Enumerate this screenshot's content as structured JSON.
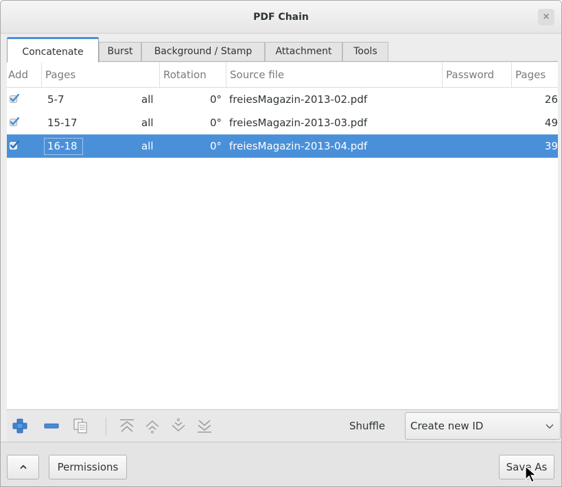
{
  "window": {
    "title": "PDF Chain",
    "close_glyph": "×"
  },
  "tabs": [
    {
      "label": "Concatenate",
      "active": true
    },
    {
      "label": "Burst",
      "active": false
    },
    {
      "label": "Background / Stamp",
      "active": false
    },
    {
      "label": "Attachment",
      "active": false
    },
    {
      "label": "Tools",
      "active": false
    }
  ],
  "table": {
    "columns": [
      "Add",
      "Pages",
      "Rotation",
      "Source file",
      "Password",
      "Pages"
    ],
    "rows": [
      {
        "add": true,
        "pages": "5-7",
        "even_odd": "all",
        "rotation": "0°",
        "source_file": "freiesMagazin-2013-02.pdf",
        "password": "",
        "page_count": "26",
        "selected": false
      },
      {
        "add": true,
        "pages": "15-17",
        "even_odd": "all",
        "rotation": "0°",
        "source_file": "freiesMagazin-2013-03.pdf",
        "password": "",
        "page_count": "49",
        "selected": false
      },
      {
        "add": true,
        "pages": "16-18",
        "even_odd": "all",
        "rotation": "0°",
        "source_file": "freiesMagazin-2013-04.pdf",
        "password": "",
        "page_count": "39",
        "selected": true
      }
    ]
  },
  "toolbar": {
    "icons": [
      "add-icon",
      "remove-icon",
      "copy-icon",
      "move-top-icon",
      "move-up-icon",
      "move-down-icon",
      "move-bottom-icon"
    ],
    "shuffle_label": "Shuffle",
    "shuffle_value": "Create new ID"
  },
  "bottom": {
    "up_glyph": "^",
    "permissions_label": "Permissions",
    "save_as_label": "Save As"
  },
  "colors": {
    "accent": "#4a90d9",
    "check": "#4a90d9",
    "add_icon": "#3f83d0"
  }
}
